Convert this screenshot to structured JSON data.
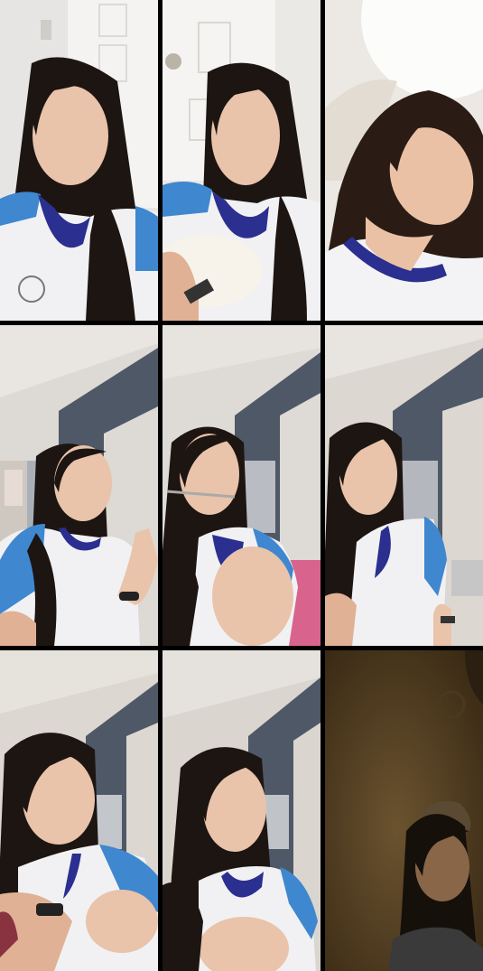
{
  "grid": {
    "rows": 3,
    "columns": 3,
    "tiles": [
      {
        "id": "r1c1",
        "scene": "door"
      },
      {
        "id": "r1c2",
        "scene": "door"
      },
      {
        "id": "r1c3",
        "scene": "bright-wall"
      },
      {
        "id": "r2c1",
        "scene": "room-column"
      },
      {
        "id": "r2c2",
        "scene": "room-column"
      },
      {
        "id": "r2c3",
        "scene": "room-column"
      },
      {
        "id": "r3c1",
        "scene": "room-column"
      },
      {
        "id": "r3c2",
        "scene": "room-column"
      },
      {
        "id": "r3c3",
        "scene": "dark-room"
      }
    ]
  },
  "colors": {
    "background": "#000000",
    "hair": "#1c1512",
    "skin": "#e9c3aa",
    "shirt_white": "#f1f1f3",
    "shirt_blue": "#3f87cf",
    "collar_navy": "#2b2f8f",
    "wall": "#ddd9d6",
    "column": "#4f5866",
    "dark_room": "#5a4324"
  }
}
